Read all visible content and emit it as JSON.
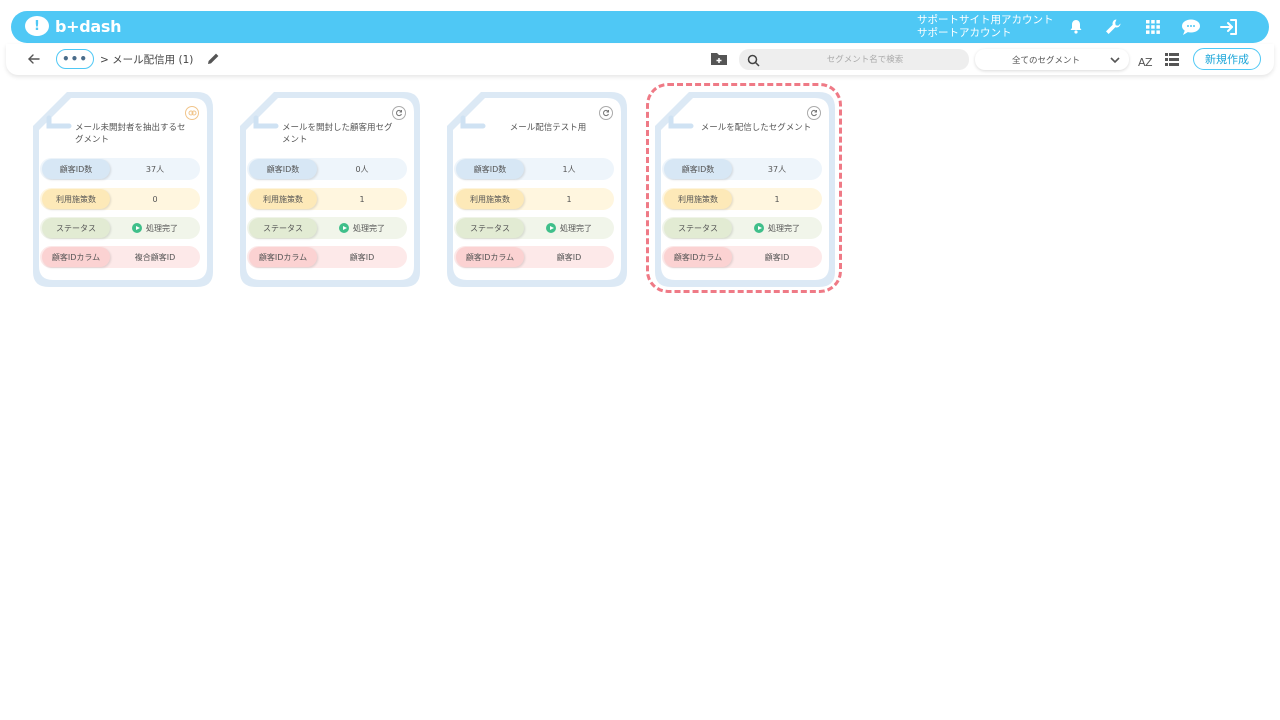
{
  "header": {
    "logo_text": "b+dash",
    "account_line1": "サポートサイト用アカウント",
    "account_line2": "サポートアカウント",
    "icons": [
      "bell-icon",
      "wrench-icon",
      "grid-icon",
      "chat-icon",
      "logout-icon"
    ]
  },
  "toolbar": {
    "breadcrumb": "> メール配信用 (1)",
    "search_placeholder": "セグメント名で検索",
    "filter_value": "全てのセグメント",
    "sort_label": "AZ",
    "new_button": "新規作成"
  },
  "colors": {
    "accent": "#4fc8f5",
    "highlight": "#ef7a86",
    "status_green": "#3fbf8a"
  },
  "cards": [
    {
      "title": "メール未開封者を抽出するセグメント",
      "rows": [
        {
          "label": "顧客ID数",
          "value": "37人"
        },
        {
          "label": "利用施策数",
          "value": "0"
        },
        {
          "label": "ステータス",
          "value": "処理完了"
        },
        {
          "label": "顧客IDカラム",
          "value": "複合顧客ID"
        }
      ]
    },
    {
      "title": "メールを開封した顧客用セグメント",
      "rows": [
        {
          "label": "顧客ID数",
          "value": "0人"
        },
        {
          "label": "利用施策数",
          "value": "1"
        },
        {
          "label": "ステータス",
          "value": "処理完了"
        },
        {
          "label": "顧客IDカラム",
          "value": "顧客ID"
        }
      ]
    },
    {
      "title": "メール配信テスト用",
      "rows": [
        {
          "label": "顧客ID数",
          "value": "1人"
        },
        {
          "label": "利用施策数",
          "value": "1"
        },
        {
          "label": "ステータス",
          "value": "処理完了"
        },
        {
          "label": "顧客IDカラム",
          "value": "顧客ID"
        }
      ]
    },
    {
      "title": "メールを配信したセグメント",
      "rows": [
        {
          "label": "顧客ID数",
          "value": "37人"
        },
        {
          "label": "利用施策数",
          "value": "1"
        },
        {
          "label": "ステータス",
          "value": "処理完了"
        },
        {
          "label": "顧客IDカラム",
          "value": "顧客ID"
        }
      ]
    }
  ]
}
